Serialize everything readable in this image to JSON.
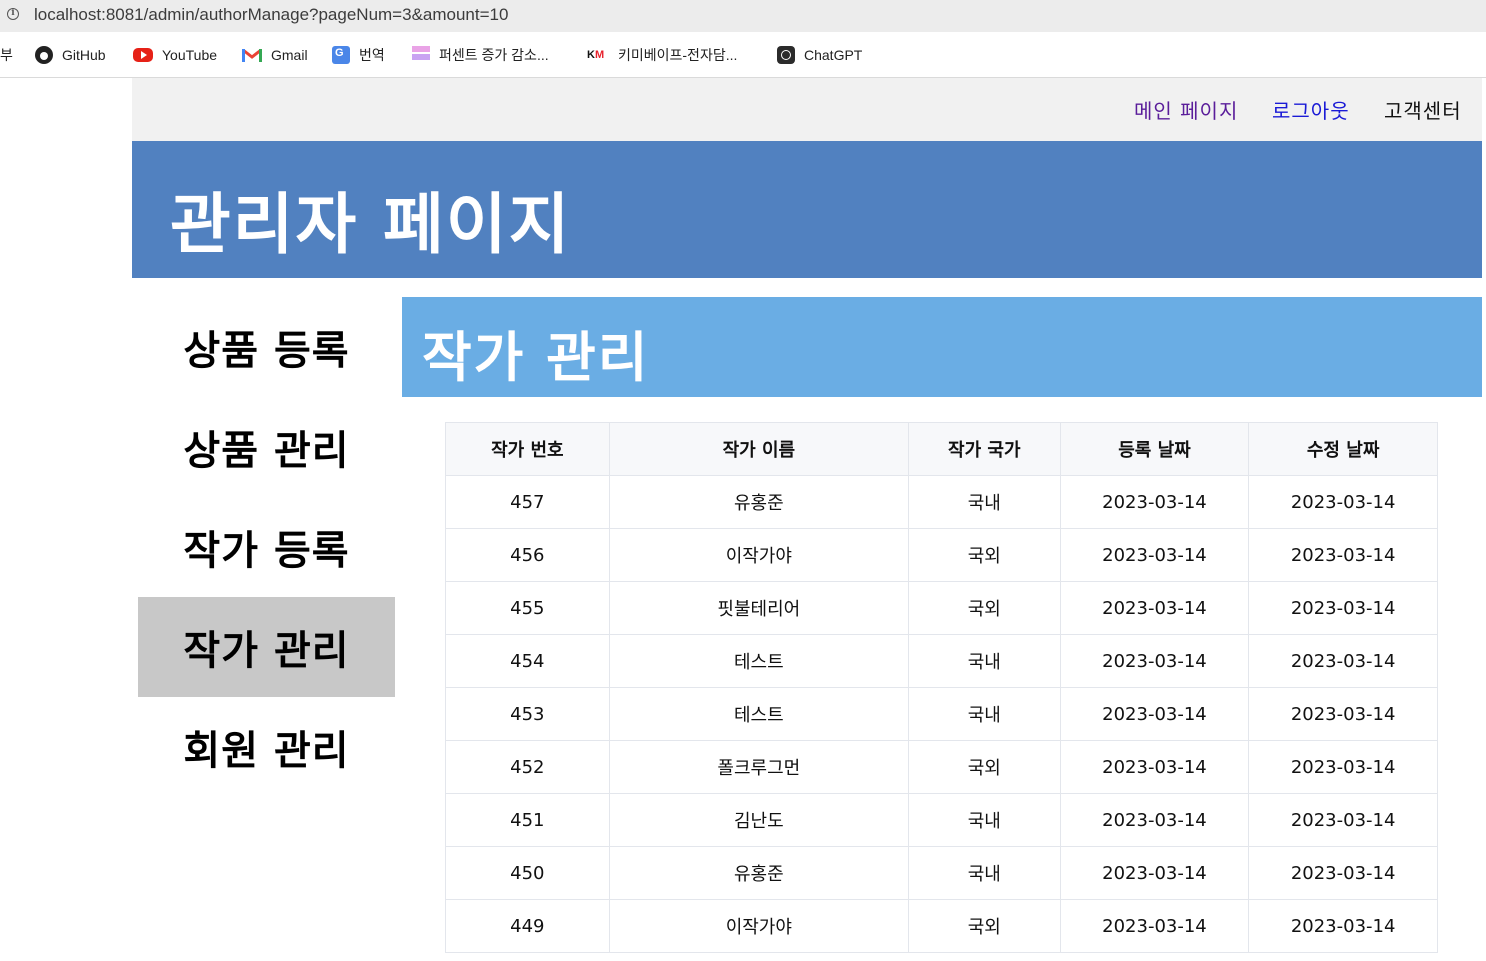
{
  "browser": {
    "url": "localhost:8081/admin/authorManage?pageNum=3&amount=10",
    "bookmarks": [
      {
        "label": "부",
        "icon": ""
      },
      {
        "label": "GitHub",
        "icon": "github-icon"
      },
      {
        "label": "YouTube",
        "icon": "youtube-icon"
      },
      {
        "label": "Gmail",
        "icon": "gmail-icon"
      },
      {
        "label": "번역",
        "icon": "translate-icon"
      },
      {
        "label": "퍼센트 증가 감소...",
        "icon": "percent-icon"
      },
      {
        "label": "키미베이프-전자담...",
        "icon": "km-icon"
      },
      {
        "label": "ChatGPT",
        "icon": "chatgpt-icon"
      }
    ]
  },
  "topnav": {
    "main": "메인 페이지",
    "logout": "로그아웃",
    "support": "고객센터"
  },
  "header": {
    "title": "관리자 페이지"
  },
  "sidebar": {
    "items": [
      {
        "label": "상품 등록"
      },
      {
        "label": "상품 관리"
      },
      {
        "label": "작가 등록"
      },
      {
        "label": "작가 관리",
        "active": true
      },
      {
        "label": "회원 관리"
      }
    ]
  },
  "content": {
    "title": "작가 관리"
  },
  "table": {
    "headers": [
      "작가 번호",
      "작가 이름",
      "작가 국가",
      "등록 날짜",
      "수정 날짜"
    ],
    "rows": [
      [
        "457",
        "유홍준",
        "국내",
        "2023-03-14",
        "2023-03-14"
      ],
      [
        "456",
        "이작가야",
        "국외",
        "2023-03-14",
        "2023-03-14"
      ],
      [
        "455",
        "핏불테리어",
        "국외",
        "2023-03-14",
        "2023-03-14"
      ],
      [
        "454",
        "테스트",
        "국내",
        "2023-03-14",
        "2023-03-14"
      ],
      [
        "453",
        "테스트",
        "국내",
        "2023-03-14",
        "2023-03-14"
      ],
      [
        "452",
        "폴크루그먼",
        "국외",
        "2023-03-14",
        "2023-03-14"
      ],
      [
        "451",
        "김난도",
        "국내",
        "2023-03-14",
        "2023-03-14"
      ],
      [
        "450",
        "유홍준",
        "국내",
        "2023-03-14",
        "2023-03-14"
      ],
      [
        "449",
        "이작가야",
        "국외",
        "2023-03-14",
        "2023-03-14"
      ]
    ]
  }
}
